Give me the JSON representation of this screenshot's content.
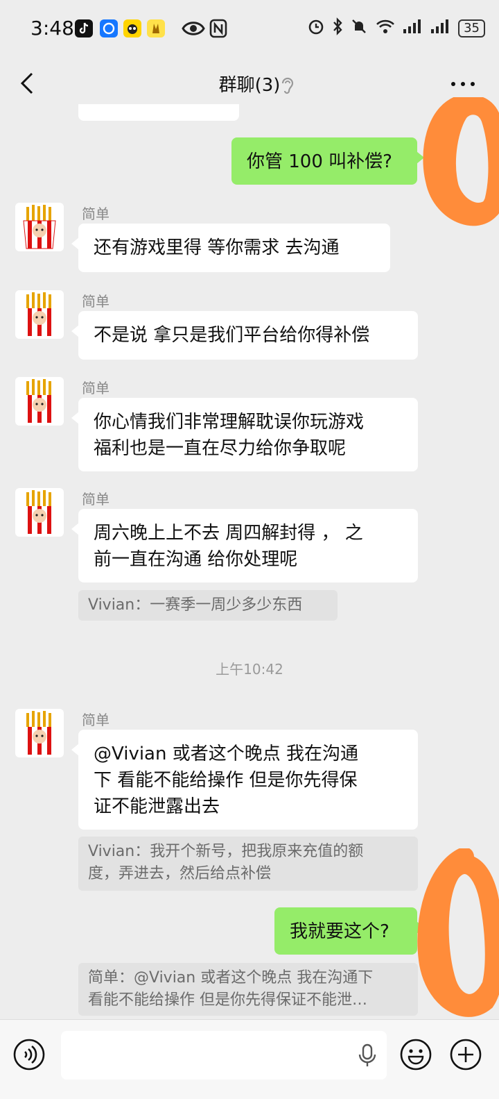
{
  "status_bar": {
    "time": "3:48",
    "battery": "35",
    "icons": [
      "tiktok-icon",
      "app-icon",
      "app-icon",
      "app-icon",
      "eye-icon",
      "nfc-icon",
      "alarm-icon",
      "bluetooth-icon",
      "mute-icon",
      "wifi-icon",
      "signal-icon",
      "signal-icon"
    ]
  },
  "header": {
    "title": "群聊(3)",
    "back_icon": "chevron-left-icon",
    "more_icon": "more-icon",
    "ear_icon": "earpiece-icon"
  },
  "messages": [
    {
      "side": "right",
      "text": "你管 100 叫补偿?"
    },
    {
      "side": "left",
      "sender": "简单",
      "text": "还有游戏里得 等你需求 去沟通"
    },
    {
      "side": "left",
      "sender": "简单",
      "text": "不是说 拿只是我们平台给你得补偿"
    },
    {
      "side": "left",
      "sender": "简单",
      "lines": [
        "你心情我们非常理解耽误你玩游戏",
        "福利也是一直在尽力给你争取呢"
      ]
    },
    {
      "side": "left",
      "sender": "简单",
      "lines": [
        "周六晚上上不去 周四解封得 ， 之",
        "前一直在沟通 给你处理呢"
      ],
      "quote": "Vivian：一赛季一周少多少东西"
    },
    {
      "side": "left",
      "sender": "简单",
      "lines": [
        "@Vivian 或者这个晚点 我在沟通",
        "下  看能不能给操作 但是你先得保",
        "证不能泄露出去"
      ],
      "quote_lines": [
        "Vivian：我开个新号，把我原来充值的额",
        "度，弄进去，然后给点补偿"
      ]
    },
    {
      "side": "right",
      "text": "我就要这个?",
      "quote_lines": [
        "简单：@Vivian 或者这个晚点 我在沟通下",
        "看能不能给操作 但是你先得保证不能泄…"
      ]
    }
  ],
  "timestamp": "上午10:42",
  "input_bar": {
    "voice_icon": "voice-icon",
    "mic_icon": "mic-icon",
    "emoji_icon": "emoji-icon",
    "plus_icon": "plus-icon"
  },
  "colors": {
    "background": "#ededed",
    "my_bubble": "#95ec69",
    "their_bubble": "#ffffff",
    "scribble": "#ff8c3a"
  }
}
